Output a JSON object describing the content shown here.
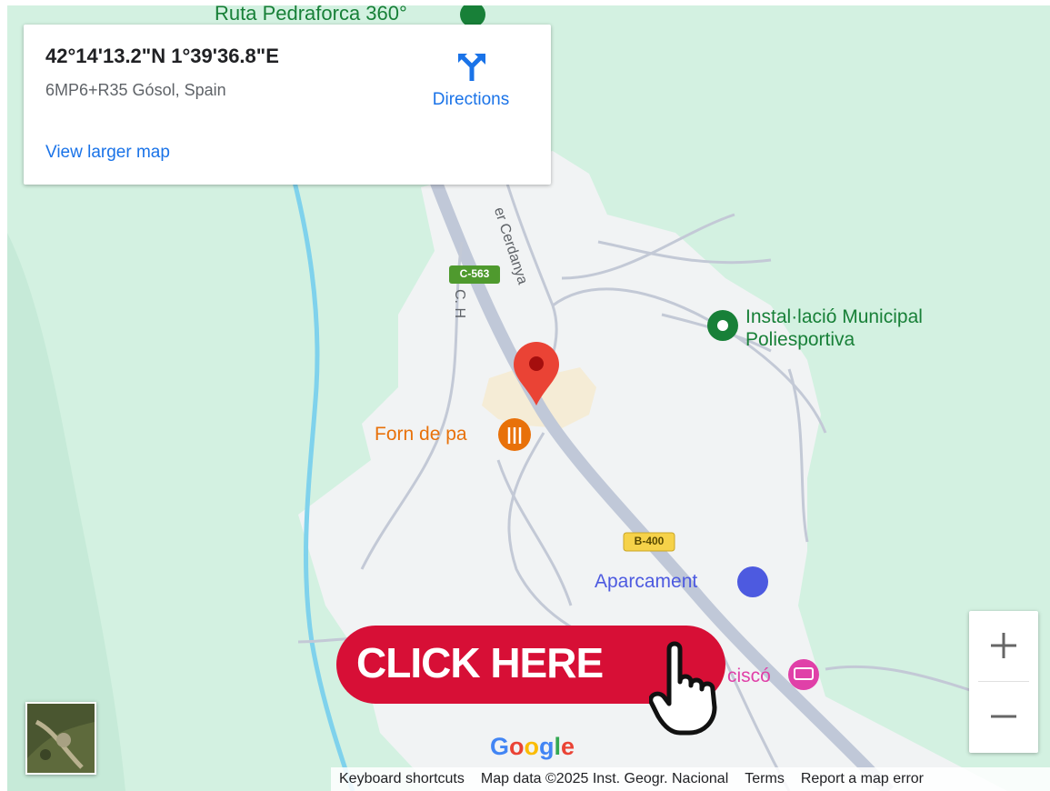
{
  "map": {
    "top_label": "Ruta Pedraforca 360°",
    "road_names": [
      "er Cerdanya",
      "C. H"
    ],
    "road_badges": [
      "C-563",
      "B-400"
    ],
    "places": [
      {
        "name": "Instal·lació Municipal\nPoliesportiva",
        "icon": "park-pin-icon",
        "color": "#188038"
      },
      {
        "name": "Forn de pa",
        "icon": "restaurant-icon",
        "color": "#e8710a"
      },
      {
        "name": "Aparcament",
        "icon": "parking-icon",
        "color": "#4d5ae0"
      },
      {
        "name": "ciscó",
        "icon": "hotel-icon",
        "color": "#e040a8"
      }
    ]
  },
  "info_card": {
    "coordinates": "42°14'13.2\"N 1°39'36.8\"E",
    "address": "6MP6+R35 Gósol, Spain",
    "directions_label": "Directions",
    "view_larger_label": "View larger map"
  },
  "controls": {
    "zoom_in": "+",
    "zoom_out": "−"
  },
  "brand": "Google",
  "footer": {
    "items": [
      "Keyboard shortcuts",
      "Map data ©2025 Inst. Geogr. Nacional",
      "Terms",
      "Report a map error"
    ]
  },
  "cta": {
    "label": "CLICK HERE"
  },
  "colors": {
    "map_green": "#d3f1e1",
    "settlement": "#f1f3f4",
    "road": "#c0c8d8",
    "water": "#7fd2ec",
    "pin": "#ea4335",
    "link": "#1a73e8",
    "cta": "#d70f36"
  }
}
